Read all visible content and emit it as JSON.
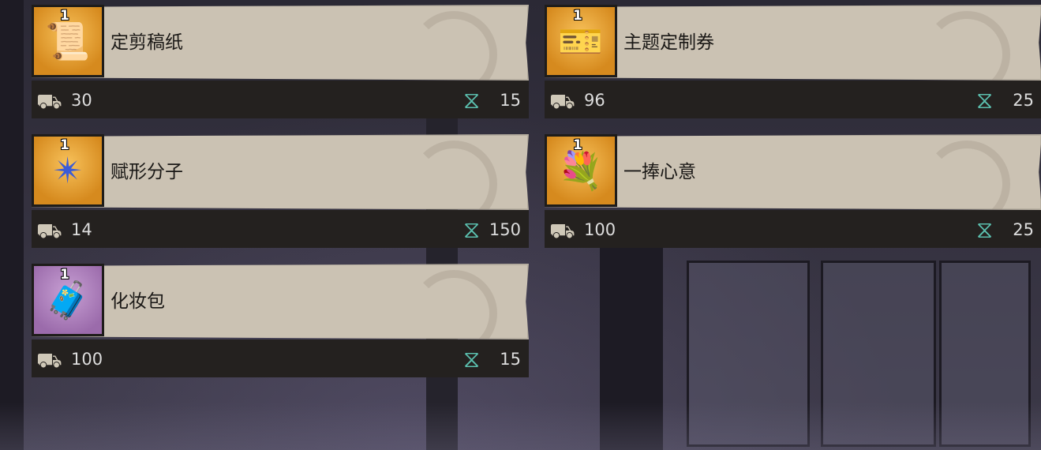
{
  "items": [
    {
      "name": "定剪稿纸",
      "qty": "1",
      "icon": "paper-scroll-icon",
      "glyph": "📜",
      "frame": "gold",
      "box_count": "30",
      "rope_count": "15"
    },
    {
      "name": "主题定制券",
      "qty": "1",
      "icon": "ticket-icon",
      "glyph": "🎫",
      "frame": "gold",
      "box_count": "96",
      "rope_count": "25"
    },
    {
      "name": "赋形分子",
      "qty": "1",
      "icon": "crystal-star-icon",
      "glyph": "✴",
      "frame": "gold",
      "box_count": "14",
      "rope_count": "150"
    },
    {
      "name": "一捧心意",
      "qty": "1",
      "icon": "flower-bouquet-icon",
      "glyph": "💐",
      "frame": "gold",
      "box_count": "100",
      "rope_count": "25"
    },
    {
      "name": "化妆包",
      "qty": "1",
      "icon": "makeup-case-icon",
      "glyph": "🧳",
      "frame": "purple",
      "box_count": "100",
      "rope_count": "15"
    }
  ],
  "colors": {
    "gold_frame": "#e8a534",
    "purple_frame": "#b385c2",
    "card_bg": "#cbc2b3",
    "footer_bg": "#24211f"
  }
}
